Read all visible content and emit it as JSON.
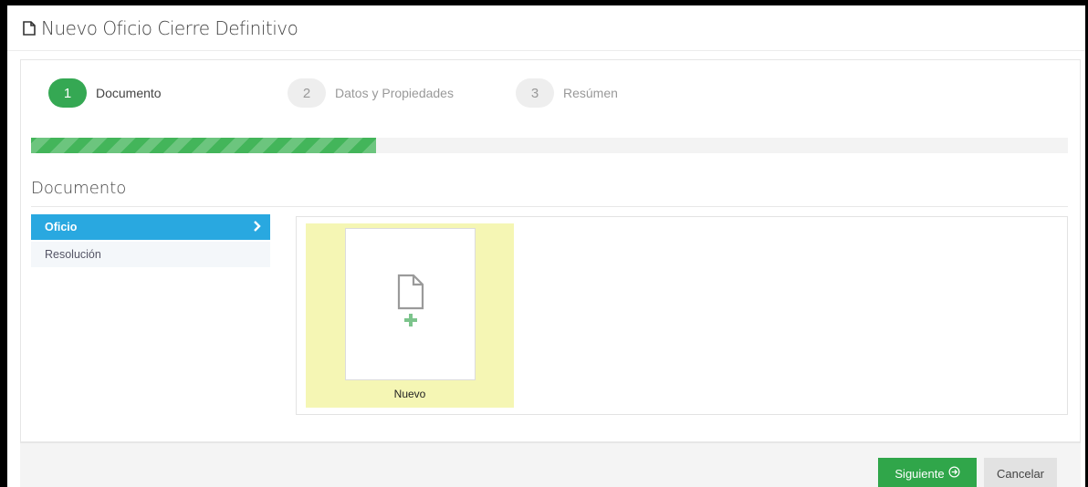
{
  "window": {
    "title": "Nuevo Oficio Cierre Definitivo",
    "title_icon": "document-icon"
  },
  "wizard": {
    "steps": [
      {
        "number": "1",
        "label": "Documento",
        "active": true
      },
      {
        "number": "2",
        "label": "Datos y Propiedades",
        "active": false
      },
      {
        "number": "3",
        "label": "Resúmen",
        "active": false
      }
    ],
    "progress": 0.333
  },
  "section": {
    "title": "Documento"
  },
  "doc_types": [
    {
      "label": "Oficio",
      "selected": true,
      "icon": "chevron-right-icon"
    },
    {
      "label": "Resolución",
      "selected": false
    }
  ],
  "documents": [
    {
      "label": "Nuevo",
      "icon": "new-document-icon"
    }
  ],
  "footer": {
    "next_label": "Siguiente",
    "next_icon": "arrow-circle-right-icon",
    "cancel_label": "Cancelar"
  },
  "colors": {
    "accent_green": "#35a853",
    "selected_blue": "#29a8e0",
    "tile_yellow": "#f5f6b4"
  }
}
